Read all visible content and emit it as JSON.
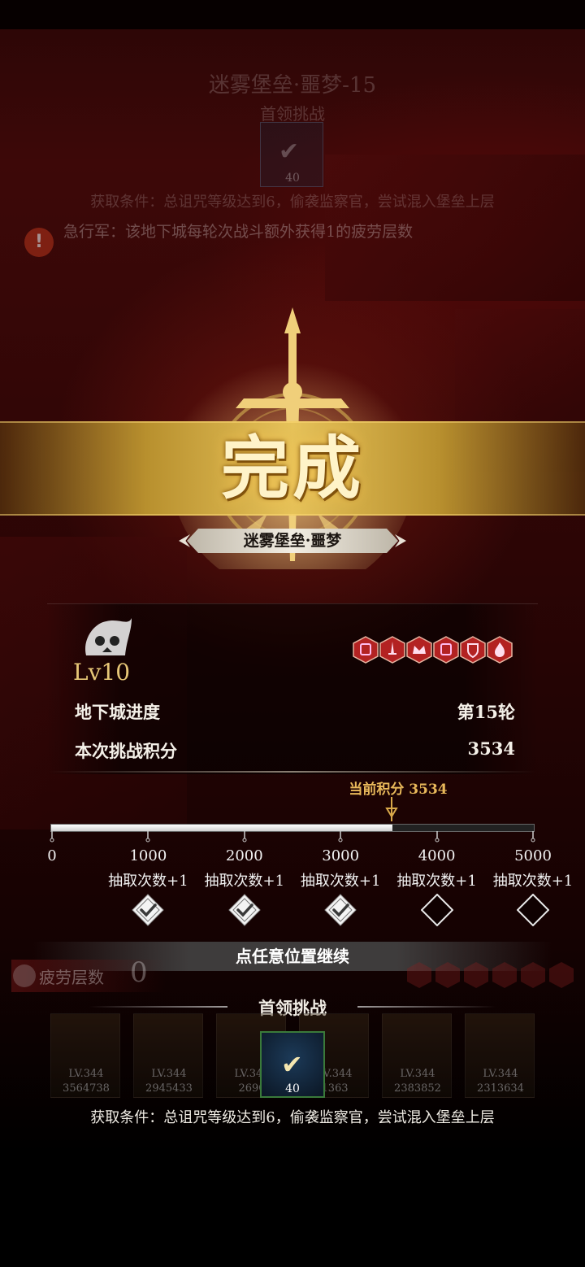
{
  "background_dim": {
    "title": "迷雾堡垒·噩梦-15",
    "subtitle": "首领挑战",
    "reward_count": "40",
    "condition": "获取条件：总诅咒等级达到6，偷袭监察官，尝试混入堡垒上层",
    "warning": "急行军：该地下城每轮次战斗额外获得1的疲劳层数"
  },
  "result": {
    "complete_label": "完成",
    "dungeon_name": "迷雾堡垒·噩梦",
    "level": "Lv10",
    "rows": [
      {
        "label": "地下城进度",
        "value": "第15轮"
      },
      {
        "label": "本次挑战积分",
        "value": "3534"
      }
    ],
    "current_score_label": "当前积分 3534",
    "score": 3534,
    "score_max": 5000
  },
  "milestones": [
    {
      "value": "0",
      "reward": "",
      "claimed": null
    },
    {
      "value": "1000",
      "reward": "抽取次数+1",
      "claimed": true
    },
    {
      "value": "2000",
      "reward": "抽取次数+1",
      "claimed": true
    },
    {
      "value": "3000",
      "reward": "抽取次数+1",
      "claimed": true
    },
    {
      "value": "4000",
      "reward": "抽取次数+1",
      "claimed": false
    },
    {
      "value": "5000",
      "reward": "抽取次数+1",
      "claimed": false
    }
  ],
  "continue_hint": "点任意位置继续",
  "fatigue": {
    "label": "疲劳层数",
    "value": "0"
  },
  "boss": {
    "title": "首领挑战",
    "reward_count": "40",
    "condition": "获取条件：总诅咒等级达到6，偷袭监察官，尝试混入堡垒上层"
  },
  "heroes": [
    {
      "level": "LV.344",
      "power": "3564738"
    },
    {
      "level": "LV.344",
      "power": "2945433"
    },
    {
      "level": "LV.344",
      "power": "2690"
    },
    {
      "level": "LV.344",
      "power": "1363"
    },
    {
      "level": "LV.344",
      "power": "2383852"
    },
    {
      "level": "LV.344",
      "power": "2313634"
    }
  ],
  "colors": {
    "gold": "#e7c777",
    "badge_red": "#b32222",
    "score_label": "#e8b85a",
    "banner_gold": "#e6c25a"
  },
  "icons": [
    "warning-icon",
    "sword-emblem-icon",
    "curse-skull-icon",
    "shield-badge-icon",
    "check-icon",
    "skull-icon"
  ]
}
